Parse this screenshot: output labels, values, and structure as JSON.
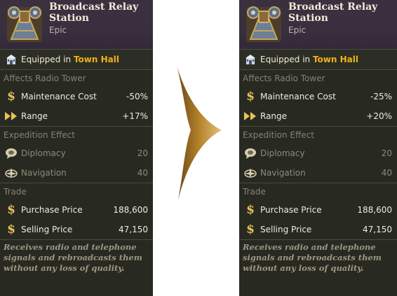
{
  "cards": [
    {
      "title": "Broadcast Relay Station",
      "rarity": "Epic",
      "equipped_prefix": "Equipped in",
      "equipped_place": "Town Hall",
      "affects_header": "Affects Radio Tower",
      "maintenance_label": "Maintenance Cost",
      "maintenance_value": "-50%",
      "range_label": "Range",
      "range_value": "+17%",
      "expedition_header": "Expedition Effect",
      "diplomacy_label": "Diplomacy",
      "diplomacy_value": "20",
      "navigation_label": "Navigation",
      "navigation_value": "40",
      "trade_header": "Trade",
      "purchase_label": "Purchase Price",
      "purchase_value": "188,600",
      "selling_label": "Selling Price",
      "selling_value": "47,150",
      "description": "Receives radio and telephone signals and rebroadcasts them without any loss of quality."
    },
    {
      "title": "Broadcast Relay Station",
      "rarity": "Epic",
      "equipped_prefix": "Equipped in",
      "equipped_place": "Town Hall",
      "affects_header": "Affects Radio Tower",
      "maintenance_label": "Maintenance Cost",
      "maintenance_value": "-25%",
      "range_label": "Range",
      "range_value": "+20%",
      "expedition_header": "Expedition Effect",
      "diplomacy_label": "Diplomacy",
      "diplomacy_value": "20",
      "navigation_label": "Navigation",
      "navigation_value": "40",
      "trade_header": "Trade",
      "purchase_label": "Purchase Price",
      "purchase_value": "188,600",
      "selling_label": "Selling Price",
      "selling_value": "47,150",
      "description": "Receives radio and telephone signals and rebroadcasts them without any loss of quality."
    }
  ],
  "icons": {
    "item": "relay-station-art",
    "equipped": "town-hall-icon",
    "money": "dollar-icon",
    "range": "double-arrow-icon",
    "diplomacy": "speech-bubble-icon",
    "navigation": "compass-icon",
    "transition": "right-arrow-icon"
  },
  "colors": {
    "panel_bg": "#282a21",
    "header_bg": "#3a3040",
    "place_highlight": "#f2b219",
    "dim_text": "#8d897a",
    "gold_icon": "#e9c35a",
    "arrow": "#b4832a"
  }
}
